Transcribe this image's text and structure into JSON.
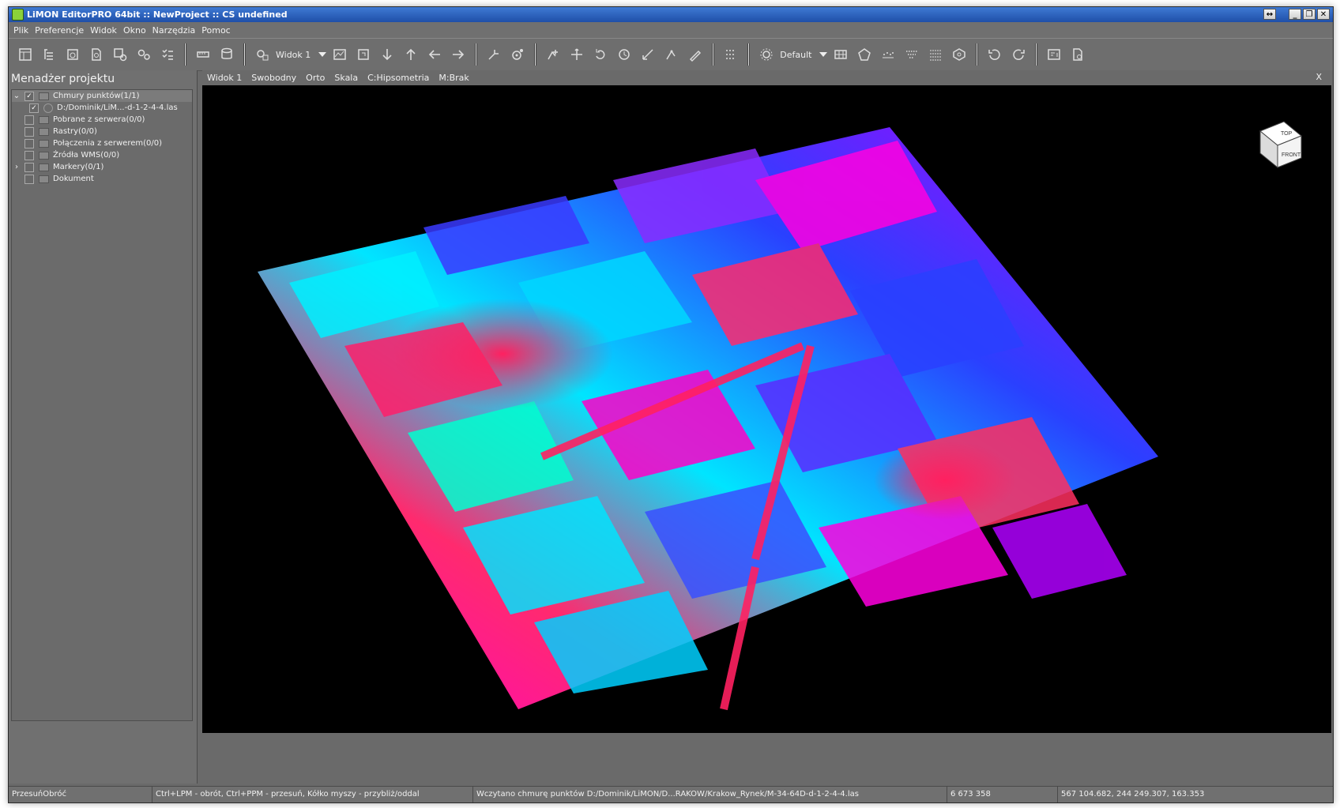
{
  "window": {
    "title": "LiMON EditorPRO 64bit :: NewProject :: CS undefined",
    "buttons": {
      "extra": "↔",
      "minimize": "_",
      "restore": "❐",
      "close": "✕"
    }
  },
  "menu": [
    "Plik",
    "Preferencje",
    "Widok",
    "Okno",
    "Narzędzia",
    "Pomoc"
  ],
  "toolbar": {
    "view_combo": "Widok 1",
    "style_combo": "Default"
  },
  "sidebar": {
    "title": "Menadżer projektu",
    "tree": [
      {
        "label": "Chmury punktów(1/1)",
        "checked": "✓",
        "expander": "⌄"
      },
      {
        "label": "D:/Dominik/LiM...-d-1-2-4-4.las",
        "checked": "✓"
      },
      {
        "label": "Pobrane z serwera(0/0)"
      },
      {
        "label": "Rastry(0/0)"
      },
      {
        "label": "Połączenia z serwerem(0/0)"
      },
      {
        "label": "Źródła WMS(0/0)"
      },
      {
        "label": "Markery(0/1)",
        "expander": "›"
      },
      {
        "label": "Dokument"
      }
    ]
  },
  "viewport": {
    "tabs": [
      "Widok 1",
      "Swobodny",
      "Orto",
      "Skala",
      "C:Hipsometria",
      "M:Brak"
    ],
    "close": "X",
    "viewcube": {
      "top": "TOP",
      "front": "FRONT"
    }
  },
  "status": {
    "mode": "PrzesuńObróć",
    "hint": "Ctrl+LPM - obrót, Ctrl+PPM - przesuń, Kółko myszy - przybliż/oddal",
    "message": "Wczytano chmurę punktów D:/Dominik/LiMON/D...RAKOW/Krakow_Rynek/M-34-64D-d-1-2-4-4.las",
    "count": "6 673 358",
    "coords": "567 104.682, 244 249.307, 163.353"
  },
  "colors": {
    "titlebar": "#2a5fc0",
    "panel": "#707070",
    "viewport_bg": "#000000"
  }
}
